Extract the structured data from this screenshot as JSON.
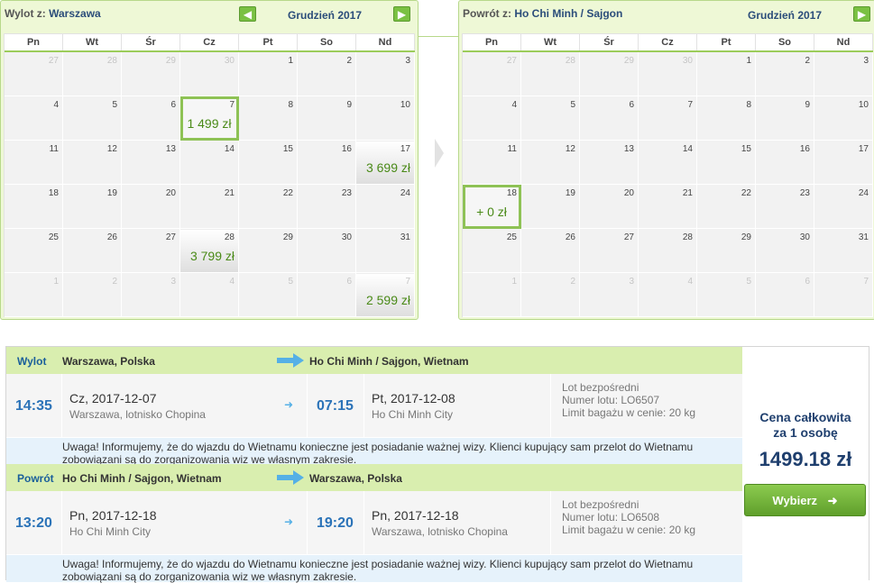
{
  "outbound_calendar": {
    "label": "Wylot z:",
    "city": "Warszawa",
    "month": "Grudzień 2017",
    "prev_icon": "arrow-left-icon",
    "next_icon": "arrow-right-icon",
    "weekdays": [
      "Pn",
      "Wt",
      "Śr",
      "Cz",
      "Pt",
      "So",
      "Nd"
    ],
    "weeks": [
      [
        {
          "d": "27",
          "dim": true
        },
        {
          "d": "28",
          "dim": true
        },
        {
          "d": "29",
          "dim": true
        },
        {
          "d": "30",
          "dim": true
        },
        {
          "d": "1"
        },
        {
          "d": "2"
        },
        {
          "d": "3"
        }
      ],
      [
        {
          "d": "4"
        },
        {
          "d": "5"
        },
        {
          "d": "6"
        },
        {
          "d": "7",
          "price": "1 499 zł",
          "selected": true
        },
        {
          "d": "8"
        },
        {
          "d": "9"
        },
        {
          "d": "10"
        }
      ],
      [
        {
          "d": "11"
        },
        {
          "d": "12"
        },
        {
          "d": "13"
        },
        {
          "d": "14"
        },
        {
          "d": "15"
        },
        {
          "d": "16"
        },
        {
          "d": "17",
          "price": "3 699 zł"
        }
      ],
      [
        {
          "d": "18"
        },
        {
          "d": "19"
        },
        {
          "d": "20"
        },
        {
          "d": "21"
        },
        {
          "d": "22"
        },
        {
          "d": "23"
        },
        {
          "d": "24"
        }
      ],
      [
        {
          "d": "25"
        },
        {
          "d": "26"
        },
        {
          "d": "27"
        },
        {
          "d": "28",
          "price": "3 799 zł"
        },
        {
          "d": "29"
        },
        {
          "d": "30"
        },
        {
          "d": "31"
        }
      ],
      [
        {
          "d": "1",
          "dim": true
        },
        {
          "d": "2",
          "dim": true
        },
        {
          "d": "3",
          "dim": true
        },
        {
          "d": "4",
          "dim": true
        },
        {
          "d": "5",
          "dim": true
        },
        {
          "d": "6",
          "dim": true
        },
        {
          "d": "7",
          "dim": true,
          "price": "2 599 zł"
        }
      ]
    ]
  },
  "return_calendar": {
    "label": "Powrót z:",
    "city": "Ho Chi Minh / Sajgon",
    "month": "Grudzień 2017",
    "next_icon": "arrow-right-icon",
    "weekdays": [
      "Pn",
      "Wt",
      "Śr",
      "Cz",
      "Pt",
      "So",
      "Nd"
    ],
    "weeks": [
      [
        {
          "d": "27",
          "dim": true
        },
        {
          "d": "28",
          "dim": true
        },
        {
          "d": "29",
          "dim": true
        },
        {
          "d": "30",
          "dim": true
        },
        {
          "d": "1"
        },
        {
          "d": "2"
        },
        {
          "d": "3"
        }
      ],
      [
        {
          "d": "4"
        },
        {
          "d": "5"
        },
        {
          "d": "6"
        },
        {
          "d": "7"
        },
        {
          "d": "8"
        },
        {
          "d": "9"
        },
        {
          "d": "10"
        }
      ],
      [
        {
          "d": "11"
        },
        {
          "d": "12"
        },
        {
          "d": "13"
        },
        {
          "d": "14"
        },
        {
          "d": "15"
        },
        {
          "d": "16"
        },
        {
          "d": "17"
        }
      ],
      [
        {
          "d": "18",
          "price": "+ 0 zł",
          "selected": true
        },
        {
          "d": "19"
        },
        {
          "d": "20"
        },
        {
          "d": "21"
        },
        {
          "d": "22"
        },
        {
          "d": "23"
        },
        {
          "d": "24"
        }
      ],
      [
        {
          "d": "25"
        },
        {
          "d": "26"
        },
        {
          "d": "27"
        },
        {
          "d": "28"
        },
        {
          "d": "29"
        },
        {
          "d": "30"
        },
        {
          "d": "31"
        }
      ],
      [
        {
          "d": "1",
          "dim": true
        },
        {
          "d": "2",
          "dim": true
        },
        {
          "d": "3",
          "dim": true
        },
        {
          "d": "4",
          "dim": true
        },
        {
          "d": "5",
          "dim": true
        },
        {
          "d": "6",
          "dim": true
        },
        {
          "d": "7",
          "dim": true
        }
      ]
    ]
  },
  "outbound": {
    "label": "Wylot",
    "from": "Warszawa, Polska",
    "to": "Ho Chi Minh / Sajgon, Wietnam",
    "dep_time": "14:35",
    "dep_day": "Cz,",
    "dep_date": "2017-12-07",
    "dep_place": "Warszawa, lotnisko Chopina",
    "arr_time": "07:15",
    "arr_day": "Pt,",
    "arr_date": "2017-12-08",
    "arr_place": "Ho Chi Minh City",
    "info1": "Lot bezpośredni",
    "info2": "Numer lotu: LO6507",
    "info3": "Limit bagażu w cenie: 20 kg",
    "note_line1": "Uwaga! Informujemy, że do wjazdu do Wietnamu konieczne jest posiadanie ważnej wizy. Klienci kupujący sam przelot do Wietnamu",
    "note_line2": "zobowiązani są do zorganizowania wiz we własnym zakresie."
  },
  "return": {
    "label": "Powrót",
    "from": "Ho Chi Minh / Sajgon, Wietnam",
    "to": "Warszawa, Polska",
    "dep_time": "13:20",
    "dep_day": "Pn,",
    "dep_date": "2017-12-18",
    "dep_place": "Ho Chi Minh City",
    "arr_time": "19:20",
    "arr_day": "Pn,",
    "arr_date": "2017-12-18",
    "arr_place": "Warszawa, lotnisko Chopina",
    "info1": "Lot bezpośredni",
    "info2": "Numer lotu: LO6508",
    "info3": "Limit bagażu w cenie: 20 kg",
    "note_line1": "Uwaga! Informujemy, że do wjazdu do Wietnamu konieczne jest posiadanie ważnej wizy. Klienci kupujący sam przelot do Wietnamu",
    "note_line2": "zobowiązani są do zorganizowania wiz we własnym zakresie."
  },
  "price": {
    "label_line1": "Cena całkowita",
    "label_line2": "za 1 osobę",
    "total": "1499.18 zł",
    "button_label": "Wybierz",
    "button_icon": "arrow-right-icon"
  },
  "colors": {
    "accent_green": "#7ac143",
    "price_green": "#4a8a18",
    "time_blue": "#2b73b8",
    "band_green": "#d9eeaf",
    "note_blue": "#e6f2fb"
  }
}
